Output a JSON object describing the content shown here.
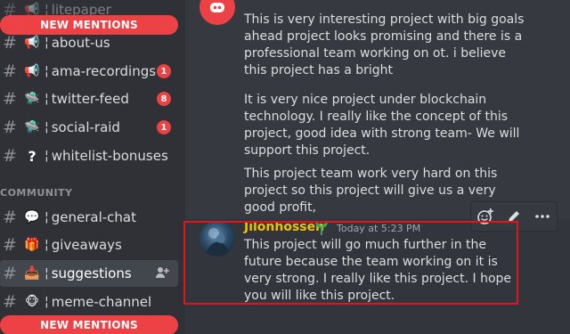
{
  "sidebar": {
    "top_partial_channel": "litepaper",
    "new_mentions_label": "NEW MENTIONS",
    "channels_top": [
      {
        "icon": "megaphone-icon",
        "name": "about-us",
        "badge": ""
      },
      {
        "icon": "megaphone-icon",
        "name": "ama-recordings",
        "badge": "1"
      },
      {
        "icon": "ufo-icon",
        "name": "twitter-feed",
        "badge": "8"
      },
      {
        "icon": "ufo-icon",
        "name": "social-raid",
        "badge": "1"
      },
      {
        "icon": "question-icon",
        "name": "whitelist-bonuses",
        "badge": ""
      }
    ],
    "category": "COMMUNITY",
    "channels_community": [
      {
        "icon": "speech-bubble-icon",
        "name": "general-chat"
      },
      {
        "icon": "gift-icon",
        "name": "giveaways"
      },
      {
        "icon": "inbox-icon",
        "name": "suggestions"
      },
      {
        "icon": "monkey-icon",
        "name": "meme-channel"
      }
    ]
  },
  "chat": {
    "messages": [
      {
        "text": "This is very interesting project with big goals ahead project looks promising and there is a professional team working on ot. i believe this project has a bright"
      },
      {
        "text": "It is  very nice project under blockchain technology. I really like the concept of this project, good idea with strong team- We will support this project."
      },
      {
        "text": "This project team work very hard on this project so this project will give us a very good profit,"
      }
    ],
    "highlighted_message": {
      "username": "Jilonhossen",
      "timestamp": "Today at 5:23 PM",
      "text": "This project will go much further in the future because the team working on it is very strong. I really like this project. I hope you will like this project."
    },
    "toolbar": [
      "add-reaction-icon",
      "edit-pencil-icon",
      "more-options-icon"
    ]
  },
  "colors": {
    "mention_red": "#ed4245",
    "username_gold": "#f0c000",
    "annotation_box": "#e0161e"
  }
}
